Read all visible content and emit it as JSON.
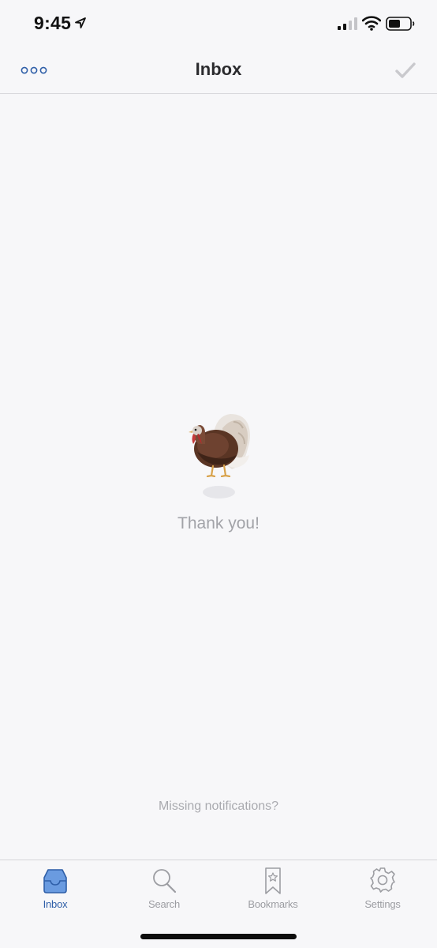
{
  "status_bar": {
    "time": "9:45",
    "icons": [
      "location-arrow-icon",
      "cellular-signal-icon",
      "wifi-icon",
      "battery-icon"
    ]
  },
  "nav": {
    "title": "Inbox",
    "left_icon": "more-dots-icon",
    "right_icon": "checkmark-icon"
  },
  "empty_state": {
    "illustration": "turkey-icon",
    "message": "Thank you!"
  },
  "footer_link": "Missing notifications?",
  "tabs": [
    {
      "label": "Inbox",
      "icon": "inbox-tray-icon",
      "active": true
    },
    {
      "label": "Search",
      "icon": "search-icon",
      "active": false
    },
    {
      "label": "Bookmarks",
      "icon": "bookmark-icon",
      "active": false
    },
    {
      "label": "Settings",
      "icon": "gear-icon",
      "active": false
    }
  ],
  "colors": {
    "background": "#f7f7f9",
    "accent": "#2f5fa8",
    "muted_text": "#a2a3a8"
  }
}
